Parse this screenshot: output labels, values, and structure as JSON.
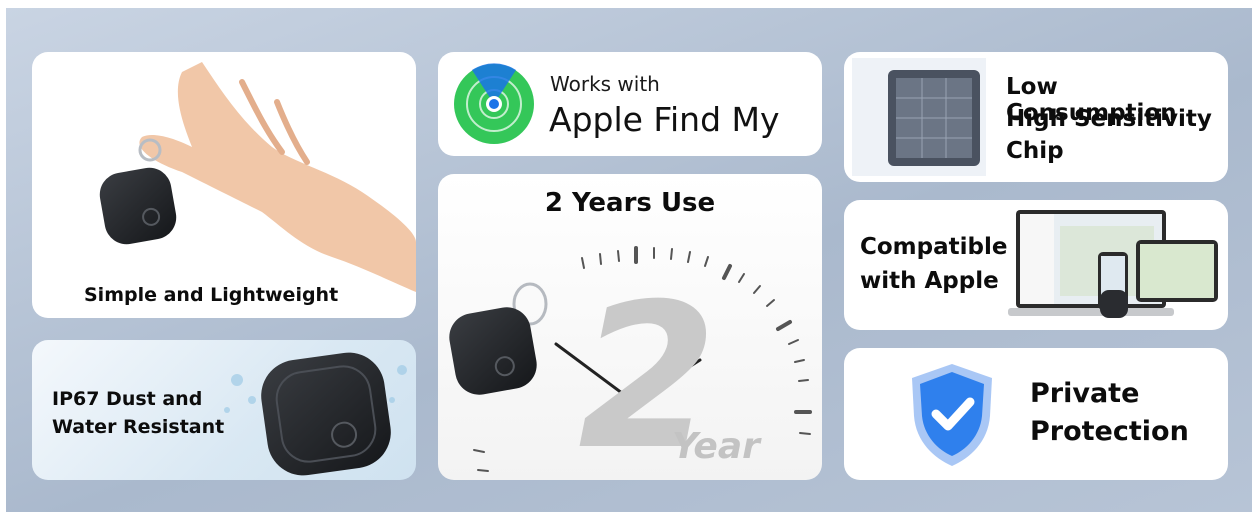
{
  "features": {
    "simple": {
      "label": "Simple and Lightweight"
    },
    "waterproof": {
      "line1": "IP67 Dust and",
      "line2": "Water Resistant"
    },
    "findmy": {
      "works_with": "Works with",
      "product": "Apple Find My"
    },
    "years": {
      "title": "2 Years Use",
      "big_number": "2",
      "year_word": "Year"
    },
    "chip": {
      "line1": "Low Consumption",
      "line2": "High Sensitivity",
      "line3": "Chip"
    },
    "compatible": {
      "line1": "Compatible",
      "line2": "with Apple"
    },
    "privacy": {
      "line1": "Private",
      "line2": "Protection"
    }
  },
  "colors": {
    "findmy_green": "#34c759",
    "findmy_blue": "#1a73e8",
    "shield_blue": "#2f80ed",
    "background": "#b3c1d3"
  }
}
